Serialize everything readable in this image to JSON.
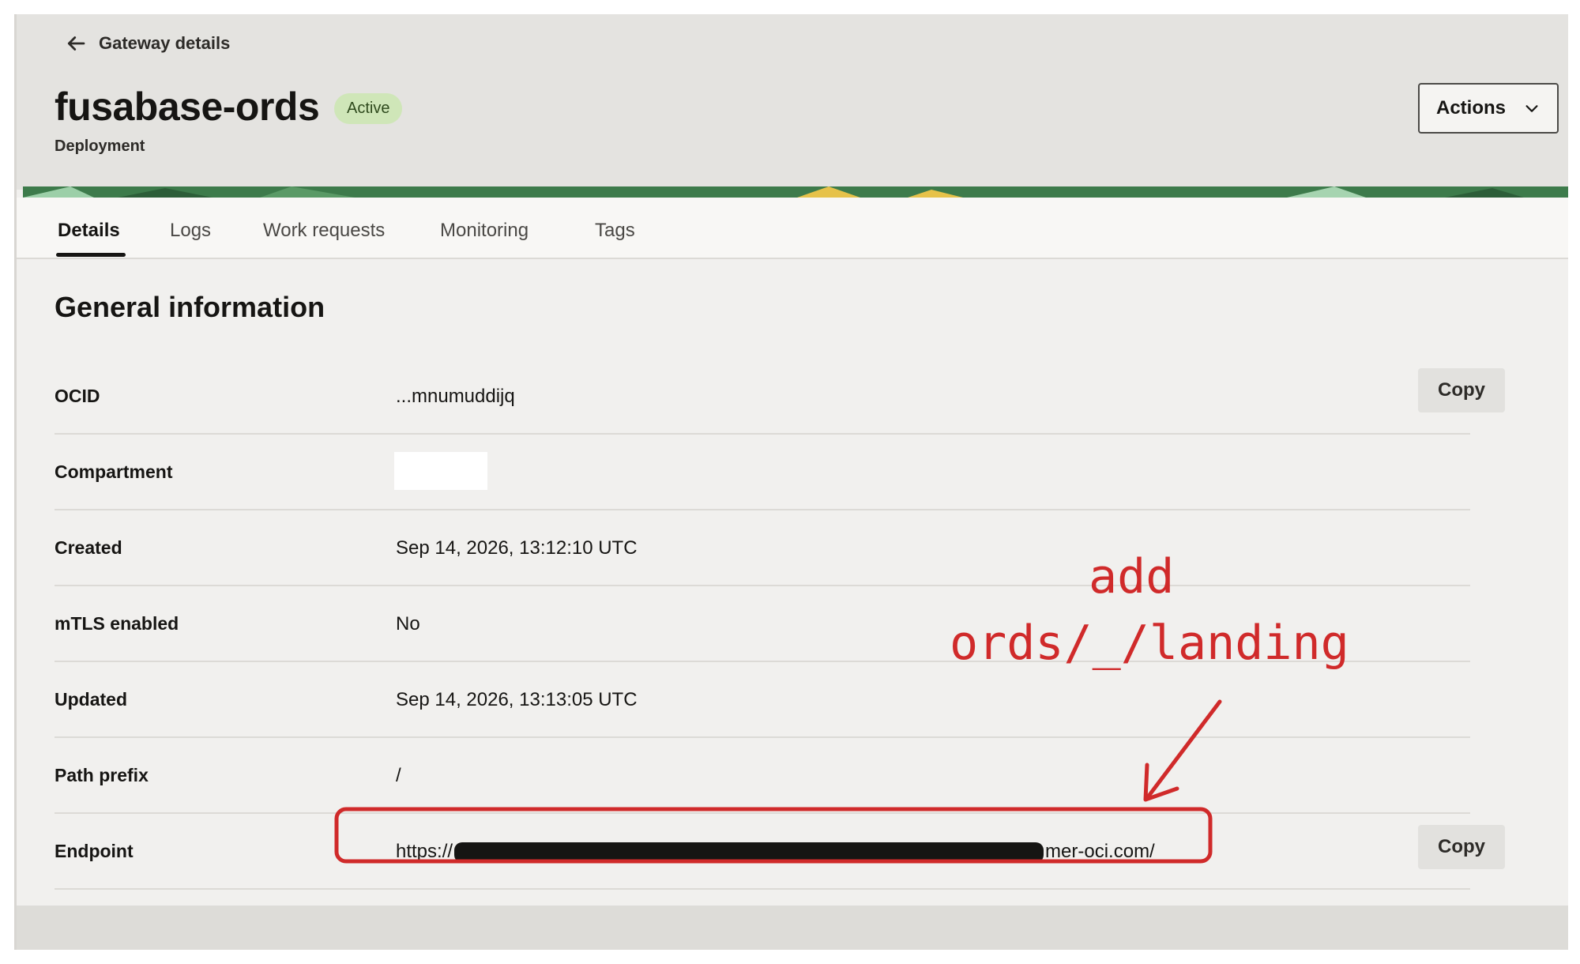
{
  "header": {
    "back_label": "Gateway details",
    "title": "fusabase-ords",
    "status_badge": "Active",
    "subtitle": "Deployment",
    "actions_label": "Actions"
  },
  "tabs": [
    {
      "label": "Details",
      "active": true
    },
    {
      "label": "Logs",
      "active": false
    },
    {
      "label": "Work requests",
      "active": false
    },
    {
      "label": "Monitoring",
      "active": false
    },
    {
      "label": "Tags",
      "active": false
    }
  ],
  "section_title": "General information",
  "fields": {
    "ocid": {
      "label": "OCID",
      "value": "...mnumuddijq"
    },
    "compartment": {
      "label": "Compartment",
      "value": ""
    },
    "created": {
      "label": "Created",
      "value": "Sep 14, 2026, 13:12:10 UTC"
    },
    "mtls": {
      "label": "mTLS enabled",
      "value": "No"
    },
    "updated": {
      "label": "Updated",
      "value": "Sep 14, 2026, 13:13:05 UTC"
    },
    "path_prefix": {
      "label": "Path prefix",
      "value": "/"
    },
    "endpoint": {
      "label": "Endpoint",
      "value_prefix": "https://",
      "value_suffix": "mer-oci.com/"
    }
  },
  "copy_label": "Copy",
  "annotation": {
    "line1": "add",
    "line2": "ords/_/landing",
    "color": "#d02a2a"
  },
  "colors": {
    "badge_bg": "#cfe6b8",
    "banner_green": "#3c7a4a",
    "annotation_red": "#d02a2a"
  },
  "icons": {
    "back": "arrow-left-icon",
    "actions": "chevron-down-icon"
  }
}
